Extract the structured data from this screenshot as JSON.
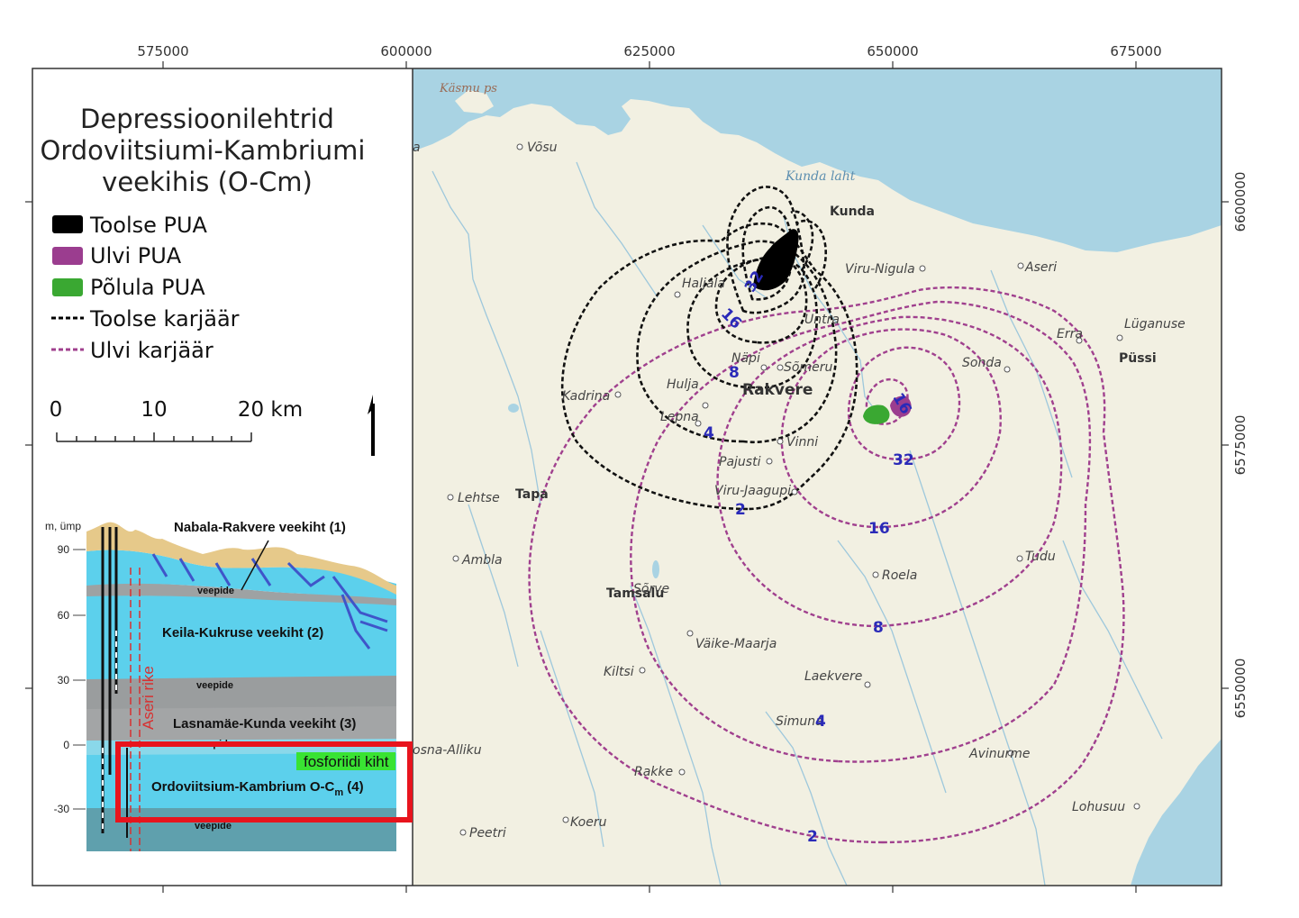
{
  "axes": {
    "x_ticks": [
      "575000",
      "600000",
      "625000",
      "650000",
      "675000"
    ],
    "y_ticks": [
      "6600000",
      "6575000",
      "6550000"
    ]
  },
  "legend": {
    "title_lines": [
      "Depressioonilehtrid",
      "Ordoviitsiumi-Kambriumi",
      "veekihis (O-Cm)"
    ],
    "items": [
      {
        "label": "Toolse PUA",
        "color": "#000000",
        "type": "fill"
      },
      {
        "label": "Ulvi PUA",
        "color": "#9b3d8f",
        "type": "fill"
      },
      {
        "label": "Põlula PUA",
        "color": "#3aa832",
        "type": "fill"
      },
      {
        "label": "Toolse karjäär",
        "color": "#000000",
        "type": "dashed"
      },
      {
        "label": "Ulvi karjäär",
        "color": "#a0408e",
        "type": "dashed"
      }
    ],
    "scale": {
      "labels": [
        "0",
        "10",
        "20 km"
      ]
    }
  },
  "section": {
    "y_unit": "m, ümp",
    "y_ticks": [
      "90",
      "60",
      "30",
      "0",
      "-30"
    ],
    "labels": {
      "nabala": "Nabala-Rakvere veekiht (1)",
      "keila": "Keila-Kukruse veekiht (2)",
      "lasnamae": "Lasnamäe-Kunda veekiht (3)",
      "ordov_main": "Ordoviitsium-Kambrium O-C",
      "ordov_sub": "m",
      "ordov_num": " (4)",
      "veepide_1": "veepide",
      "veepide_2": "veepide",
      "veepide_3": "veepide",
      "veepide_4": "veepide",
      "fault": "Aseri rike",
      "fosforiit": "fosforiidi kiht"
    }
  },
  "map": {
    "colors": {
      "sea": "#a9d3e3",
      "land": "#f2f0e2",
      "river": "#9ec8dc"
    },
    "water_labels": [
      "Käsmu ps",
      "Kunda laht"
    ],
    "towns": {
      "rakvere": "Rakvere",
      "kunda": "Kunda",
      "tapa": "Tapa",
      "tamsalu": "Tamsalu",
      "pussi": "Püssi"
    },
    "places": {
      "vosu": "Võsu",
      "haljala": "Haljala",
      "viru_nigula": "Viru-Nigula",
      "aseri": "Aseri",
      "untra": "Untra",
      "erra": "Erra",
      "luganuse": "Lüganuse",
      "napi": "Näpi",
      "someru": "Sõmeru",
      "sonda": "Sonda",
      "hulja": "Hulja",
      "kadrina": "Kadrina",
      "lepna": "Lepna",
      "vinni": "Vinni",
      "pajusti": "Pajusti",
      "viru_jaagupi": "Viru-Jaagupi",
      "lehtse": "Lehtse",
      "ambla": "Ambla",
      "tudu": "Tudu",
      "roela": "Roela",
      "saare": "Sõrve",
      "vaike_maarja": "Väike-Maarja",
      "kiltsi": "Kiltsi",
      "laekvere": "Laekvere",
      "simuna": "Simuna",
      "avinurme": "Avinurme",
      "rakke": "Rakke",
      "lohusuu": "Lohusuu",
      "koeru": "Koeru",
      "peetri": "Peetri",
      "kosna": "osna-Alliku",
      "edge_a": "a"
    },
    "contour_labels": {
      "t32": "32",
      "t16": "16",
      "t8": "8",
      "t4": "4",
      "t2": "2",
      "u16top": "16",
      "u32": "32",
      "u16": "16",
      "u8": "8",
      "u4": "4",
      "u2": "2"
    }
  }
}
